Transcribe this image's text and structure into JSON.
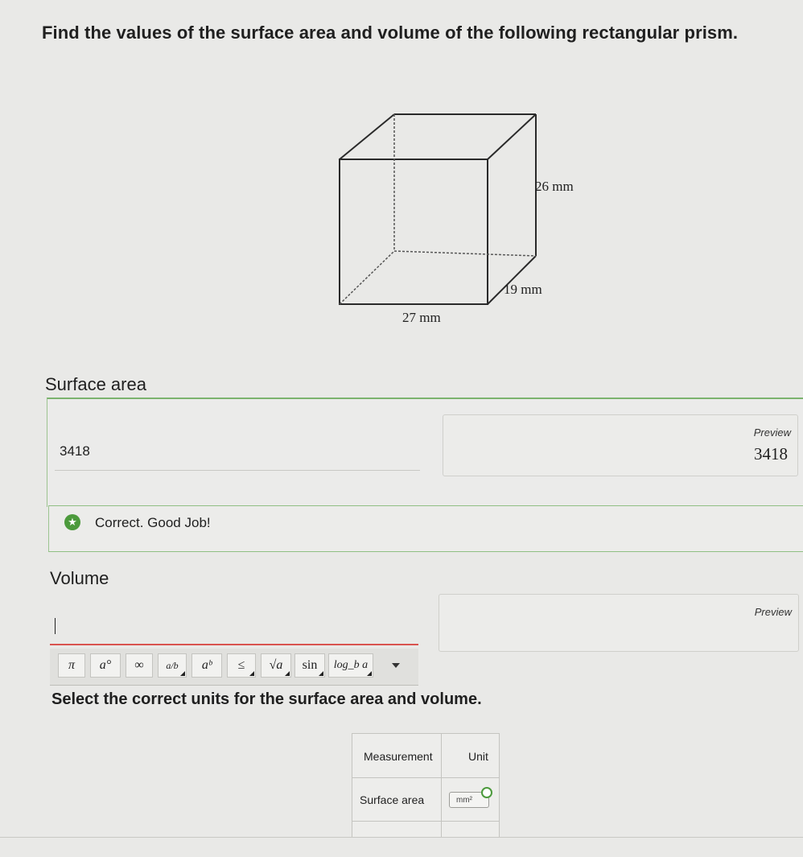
{
  "question": "Find the values of the surface area and volume of the following rectangular prism.",
  "figure": {
    "height_label": "26 mm",
    "depth_label": "19 mm",
    "width_label": "27 mm"
  },
  "surface_area": {
    "label": "Surface area",
    "value": "3418",
    "preview_title": "Preview",
    "preview_value": "3418",
    "feedback": "Correct. Good Job!"
  },
  "volume": {
    "label": "Volume",
    "value": "",
    "preview_title": "Preview"
  },
  "toolbar": {
    "pi": "π",
    "degree": "a°",
    "infinity": "∞",
    "fraction": "a/b",
    "power": "aᵇ",
    "leq": "≤",
    "sqrt": "√a",
    "sin": "sin",
    "log": "log_b a"
  },
  "units": {
    "prompt": "Select the correct units for the surface area and volume.",
    "header_measurement": "Measurement",
    "header_unit": "Unit",
    "rows": [
      {
        "measurement": "Surface area",
        "unit": "mm²"
      }
    ]
  },
  "colors": {
    "correct_green": "#4c9a3c",
    "error_red": "#d9534f"
  }
}
